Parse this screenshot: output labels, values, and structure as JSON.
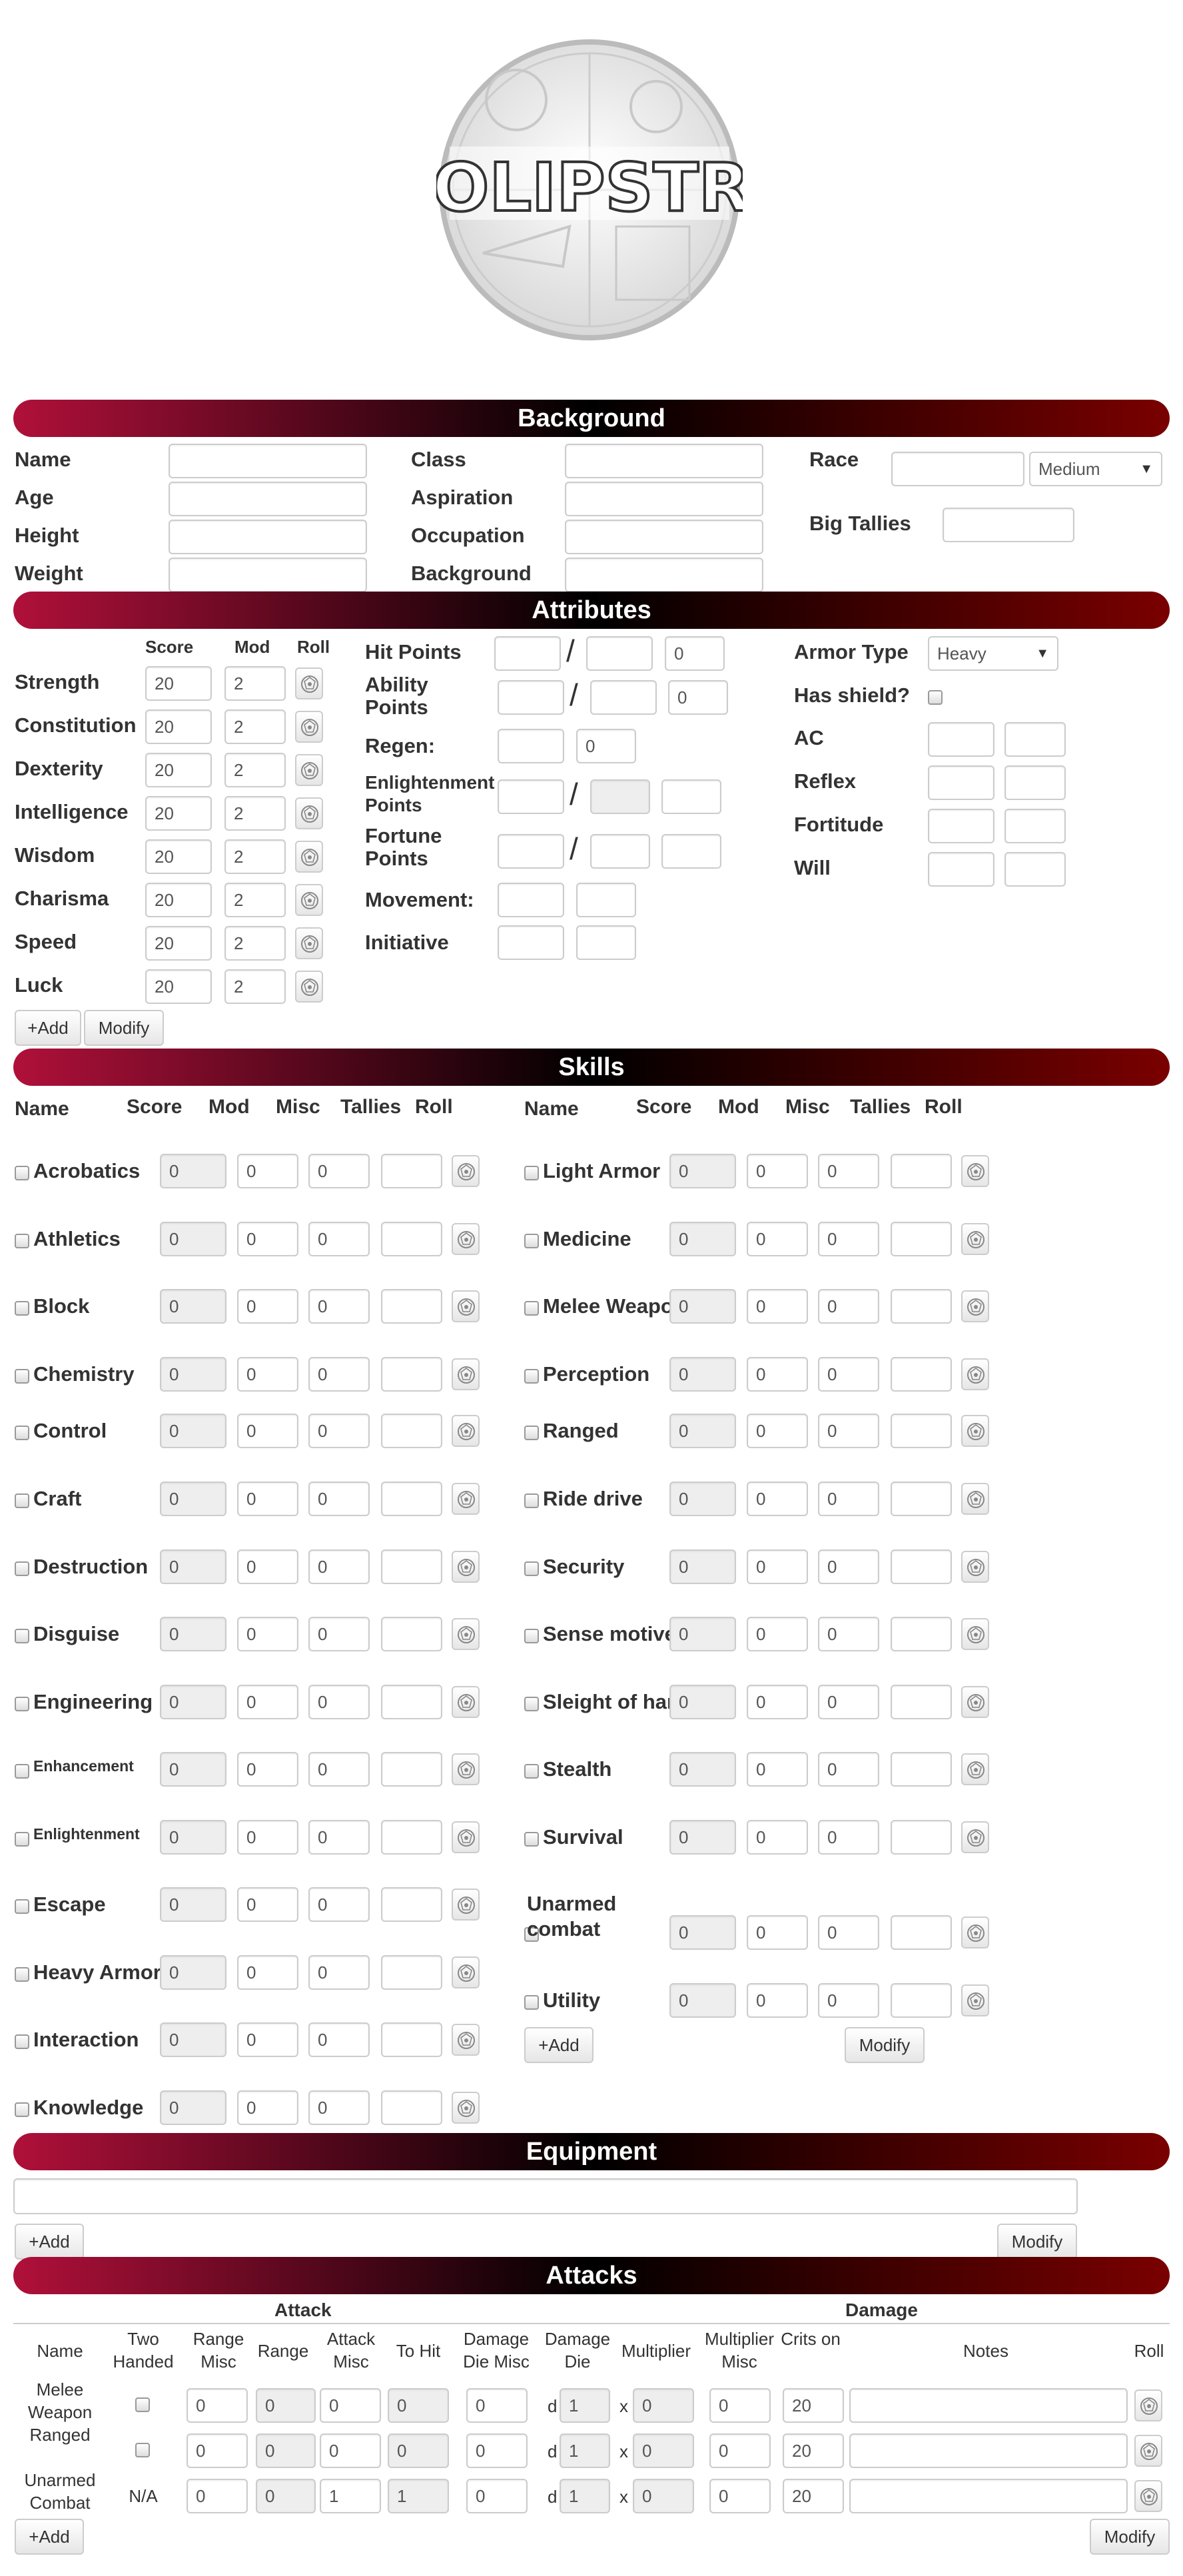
{
  "logo": {
    "text": "SOLIPSTRY"
  },
  "sections": {
    "background": "Background",
    "attributes": "Attributes",
    "skills": "Skills",
    "equipment": "Equipment",
    "attacks": "Attacks"
  },
  "background": {
    "name": "Name",
    "age": "Age",
    "height": "Height",
    "weight": "Weight",
    "class": "Class",
    "aspiration": "Aspiration",
    "occupation": "Occupation",
    "background": "Background",
    "race": "Race",
    "size_value": "Medium",
    "big_tallies": "Big Tallies"
  },
  "attributes": {
    "col_score": "Score",
    "col_mod": "Mod",
    "col_roll": "Roll",
    "rows": [
      {
        "name": "Strength",
        "score": "20",
        "mod": "2"
      },
      {
        "name": "Constitution",
        "score": "20",
        "mod": "2"
      },
      {
        "name": "Dexterity",
        "score": "20",
        "mod": "2"
      },
      {
        "name": "Intelligence",
        "score": "20",
        "mod": "2"
      },
      {
        "name": "Wisdom",
        "score": "20",
        "mod": "2"
      },
      {
        "name": "Charisma",
        "score": "20",
        "mod": "2"
      },
      {
        "name": "Speed",
        "score": "20",
        "mod": "2"
      },
      {
        "name": "Luck",
        "score": "20",
        "mod": "2"
      }
    ],
    "add": "+Add",
    "modify": "Modify",
    "hit_points": "Hit Points",
    "hp_temp": "0",
    "ability_points": "Ability Points",
    "ap_temp": "0",
    "regen": "Regen:",
    "regen_value": "0",
    "enlightenment_points": "Enlightenment Points",
    "fortune_points": "Fortune Points",
    "movement": "Movement:",
    "initiative": "Initiative",
    "armor_type": "Armor Type",
    "armor_value": "Heavy",
    "has_shield": "Has shield?",
    "ac": "AC",
    "reflex": "Reflex",
    "fortitude": "Fortitude",
    "will": "Will"
  },
  "skills": {
    "headers": {
      "name": "Name",
      "score": "Score",
      "mod": "Mod",
      "misc": "Misc",
      "tallies": "Tallies",
      "roll": "Roll"
    },
    "left": [
      {
        "name": "Acrobatics",
        "score": "0",
        "mod": "0",
        "misc": "0"
      },
      {
        "name": "Athletics",
        "score": "0",
        "mod": "0",
        "misc": "0"
      },
      {
        "name": "Block",
        "score": "0",
        "mod": "0",
        "misc": "0"
      },
      {
        "name": "Chemistry",
        "score": "0",
        "mod": "0",
        "misc": "0"
      },
      {
        "name": "Control",
        "score": "0",
        "mod": "0",
        "misc": "0"
      },
      {
        "name": "Craft",
        "score": "0",
        "mod": "0",
        "misc": "0"
      },
      {
        "name": "Destruction",
        "score": "0",
        "mod": "0",
        "misc": "0"
      },
      {
        "name": "Disguise",
        "score": "0",
        "mod": "0",
        "misc": "0"
      },
      {
        "name": "Engineering",
        "score": "0",
        "mod": "0",
        "misc": "0"
      },
      {
        "name": "Enhancement",
        "score": "0",
        "mod": "0",
        "misc": "0"
      },
      {
        "name": "Enlightenment",
        "score": "0",
        "mod": "0",
        "misc": "0"
      },
      {
        "name": "Escape",
        "score": "0",
        "mod": "0",
        "misc": "0"
      },
      {
        "name": "Heavy Armor",
        "score": "0",
        "mod": "0",
        "misc": "0"
      },
      {
        "name": "Interaction",
        "score": "0",
        "mod": "0",
        "misc": "0"
      },
      {
        "name": "Knowledge",
        "score": "0",
        "mod": "0",
        "misc": "0"
      }
    ],
    "right": [
      {
        "name": "Light Armor",
        "score": "0",
        "mod": "0",
        "misc": "0"
      },
      {
        "name": "Medicine",
        "score": "0",
        "mod": "0",
        "misc": "0"
      },
      {
        "name": "Melee Weapon",
        "score": "0",
        "mod": "0",
        "misc": "0"
      },
      {
        "name": "Perception",
        "score": "0",
        "mod": "0",
        "misc": "0"
      },
      {
        "name": "Ranged",
        "score": "0",
        "mod": "0",
        "misc": "0"
      },
      {
        "name": "Ride drive",
        "score": "0",
        "mod": "0",
        "misc": "0"
      },
      {
        "name": "Security",
        "score": "0",
        "mod": "0",
        "misc": "0"
      },
      {
        "name": "Sense motive",
        "score": "0",
        "mod": "0",
        "misc": "0"
      },
      {
        "name": "Sleight of hand",
        "score": "0",
        "mod": "0",
        "misc": "0"
      },
      {
        "name": "Stealth",
        "score": "0",
        "mod": "0",
        "misc": "0"
      },
      {
        "name": "Survival",
        "score": "0",
        "mod": "0",
        "misc": "0"
      },
      {
        "name": "Unarmed combat",
        "score": "0",
        "mod": "0",
        "misc": "0"
      },
      {
        "name": "Utility",
        "score": "0",
        "mod": "0",
        "misc": "0"
      }
    ],
    "add": "+Add",
    "modify": "Modify"
  },
  "equipment": {
    "add": "+Add",
    "modify": "Modify"
  },
  "attacks": {
    "group_attack": "Attack",
    "group_damage": "Damage",
    "headers": {
      "name": "Name",
      "two_handed": "Two Handed",
      "range_misc": "Range Misc",
      "range": "Range",
      "attack_misc": "Attack Misc",
      "to_hit": "To Hit",
      "damage_die_misc": "Damage Die Misc",
      "damage_die": "Damage Die",
      "multiplier": "Multiplier",
      "multiplier_misc": "Multiplier Misc",
      "crits_on": "Crits on",
      "notes": "Notes",
      "roll": "Roll"
    },
    "d": "d",
    "x": "x",
    "rows": [
      {
        "name": "Melee Weapon",
        "two_handed": "",
        "range_misc": "0",
        "range": "0",
        "attack_misc": "0",
        "to_hit": "0",
        "die_misc": "0",
        "die": "1",
        "mult": "0",
        "mult_misc": "0",
        "crits": "20"
      },
      {
        "name": "Ranged",
        "two_handed": "",
        "range_misc": "0",
        "range": "0",
        "attack_misc": "0",
        "to_hit": "0",
        "die_misc": "0",
        "die": "1",
        "mult": "0",
        "mult_misc": "0",
        "crits": "20"
      },
      {
        "name": "Unarmed Combat",
        "two_handed": "N/A",
        "range_misc": "0",
        "range": "0",
        "attack_misc": "1",
        "to_hit": "1",
        "die_misc": "0",
        "die": "1",
        "mult": "0",
        "mult_misc": "0",
        "crits": "20"
      }
    ],
    "add": "+Add",
    "modify": "Modify"
  },
  "colors": {
    "bar_left": "#b0103a",
    "bar_mid": "#000000",
    "bar_right": "#7a0000"
  }
}
